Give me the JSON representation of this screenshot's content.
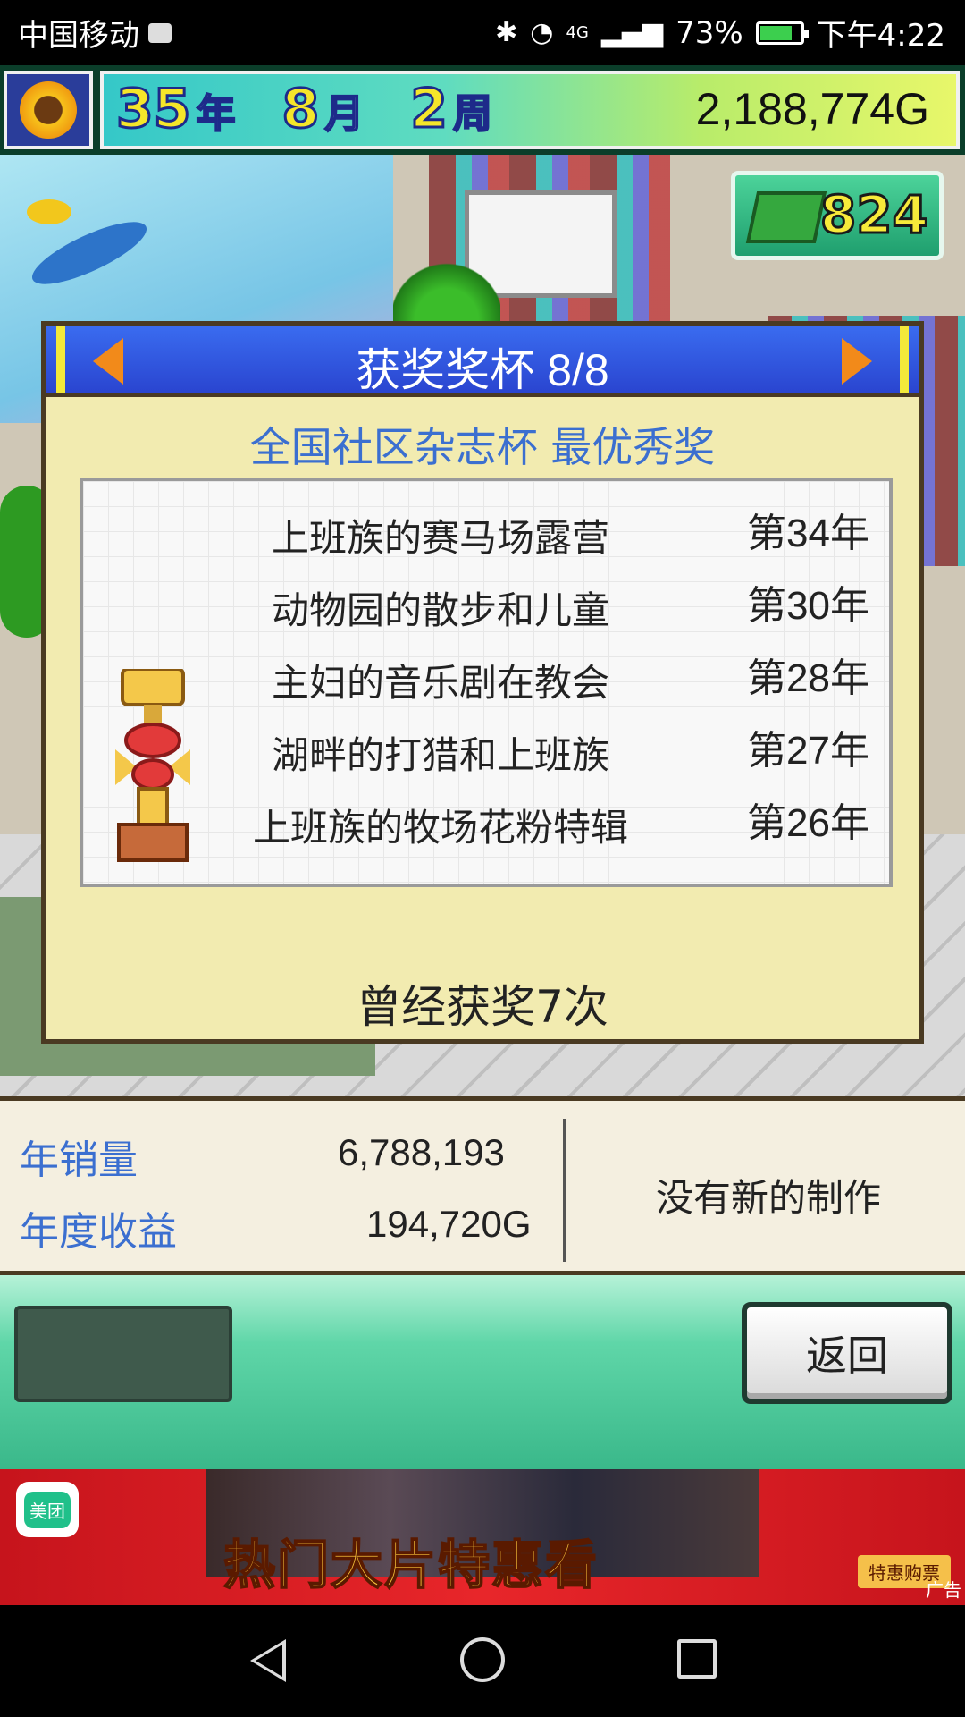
{
  "status_bar": {
    "carrier": "中国移动",
    "network": "4G",
    "battery": "73%",
    "time": "下午4:22"
  },
  "hud": {
    "year_num": "35",
    "year_unit": "年",
    "month_num": "8",
    "month_unit": "月",
    "week_num": "2",
    "week_unit": "周",
    "money": "2,188,774G",
    "points": "824"
  },
  "award_panel": {
    "title": "获奖奖杯 8/8",
    "award_name": "全国社区杂志杯 最优秀奖",
    "entries": [
      {
        "title": "上班族的赛马场露营",
        "year": "第34年"
      },
      {
        "title": "动物园的散步和儿童",
        "year": "第30年"
      },
      {
        "title": "主妇的音乐剧在教会",
        "year": "第28年"
      },
      {
        "title": "湖畔的打猎和上班族",
        "year": "第27年"
      },
      {
        "title": "上班族的牧场花粉特辑",
        "year": "第26年"
      }
    ],
    "count_text": "曾经获奖7次"
  },
  "stats": {
    "sales_label": "年销量",
    "sales_value": "6,788,193",
    "profit_label": "年度收益",
    "profit_value": "194,720G",
    "note": "没有新的制作"
  },
  "controls": {
    "back_label": "返回"
  },
  "ad": {
    "brand": "美团",
    "headline": "热门大片特惠看",
    "buy_label": "特惠购票",
    "tag": "广告"
  },
  "colors": {
    "header_blue": "#2a45d0",
    "award_name_blue": "#3b6fd0",
    "panel_bg": "#f2ebb0",
    "hud_green": "#5fdcc0"
  }
}
